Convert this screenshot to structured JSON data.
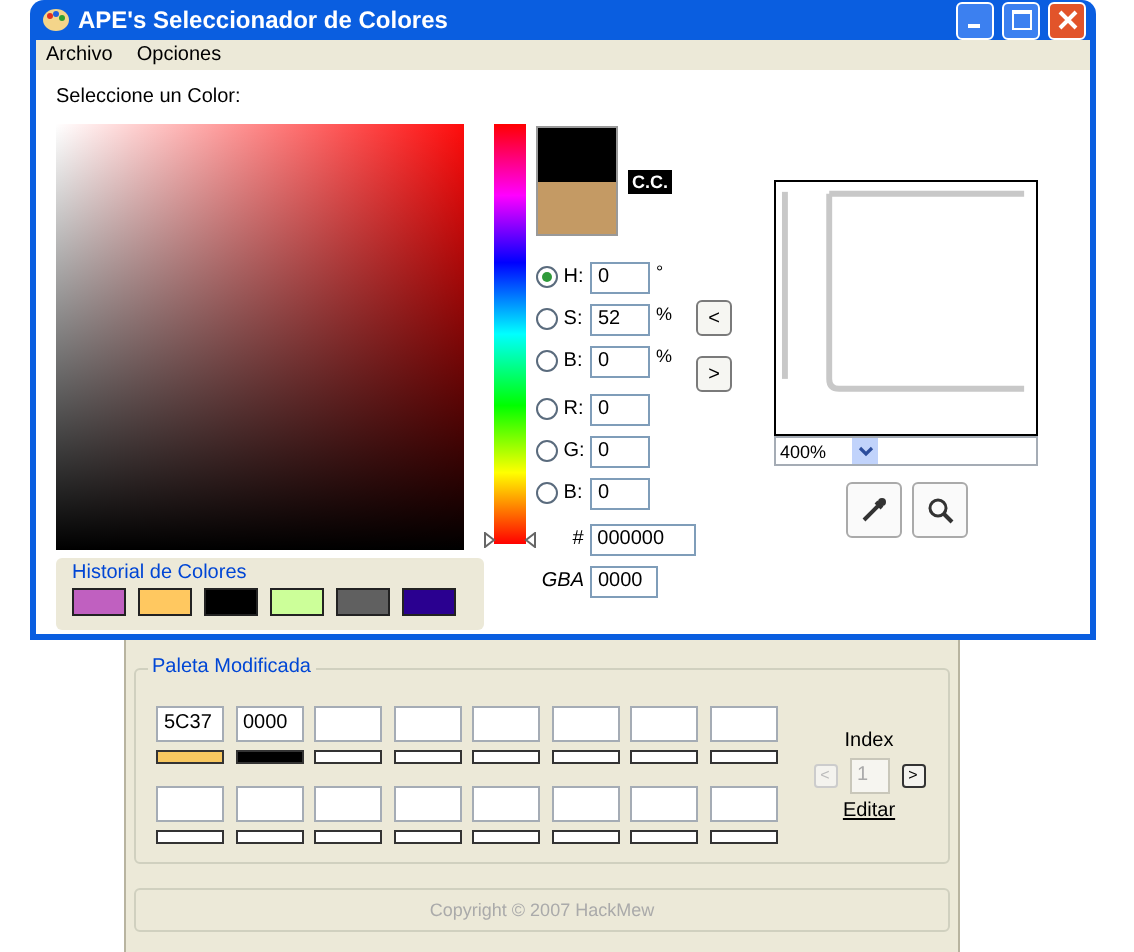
{
  "window": {
    "title": "APE's Seleccionador de Colores"
  },
  "menu": [
    {
      "label": "Archivo"
    },
    {
      "label": "Opciones"
    }
  ],
  "prompt": "Seleccione un Color:",
  "current_color": {
    "label": "C.C."
  },
  "fields": [
    {
      "kind": "radio",
      "label": "H:",
      "value": "0",
      "unit": "°",
      "selected": true
    },
    {
      "kind": "radio",
      "label": "S:",
      "value": "52",
      "unit": "%",
      "selected": false
    },
    {
      "kind": "radio",
      "label": "B:",
      "value": "0",
      "unit": "%",
      "selected": false
    },
    {
      "kind": "radio",
      "label": "R:",
      "value": "0",
      "selected": false
    },
    {
      "kind": "radio",
      "label": "G:",
      "value": "0",
      "selected": false
    },
    {
      "kind": "radio",
      "label": "B:",
      "value": "0",
      "selected": false
    },
    {
      "kind": "hex",
      "label": "#",
      "value": "000000"
    },
    {
      "kind": "gba",
      "label": "GBA",
      "value": "0000"
    }
  ],
  "nav_buttons": [
    {
      "label": "<"
    },
    {
      "label": ">"
    }
  ],
  "zoom": {
    "value": "400%"
  },
  "history": {
    "title": "Historial de Colores",
    "swatches": [
      {
        "color": "#c060c0"
      },
      {
        "color": "#ffc860"
      },
      {
        "color": "#000000"
      },
      {
        "color": "#ccff99"
      },
      {
        "color": "#606060"
      },
      {
        "color": "#2a0090"
      }
    ]
  },
  "palette": {
    "title": "Paleta Modificada",
    "slots": [
      {
        "kind": "filled",
        "value": "5C37",
        "color": "#f8c860"
      },
      {
        "kind": "filled",
        "value": "0000",
        "color": "#000000"
      },
      {
        "kind": "empty"
      },
      {
        "kind": "empty"
      },
      {
        "kind": "empty"
      },
      {
        "kind": "empty"
      },
      {
        "kind": "empty"
      },
      {
        "kind": "empty"
      },
      {
        "kind": "empty"
      },
      {
        "kind": "empty"
      },
      {
        "kind": "empty"
      },
      {
        "kind": "empty"
      },
      {
        "kind": "empty"
      },
      {
        "kind": "empty"
      },
      {
        "kind": "empty"
      },
      {
        "kind": "empty"
      }
    ],
    "index_label": "Index",
    "prev": "<",
    "index": "1",
    "next": ">",
    "edit": "Editar"
  },
  "copyright": "Copyright © 2007 HackMew"
}
